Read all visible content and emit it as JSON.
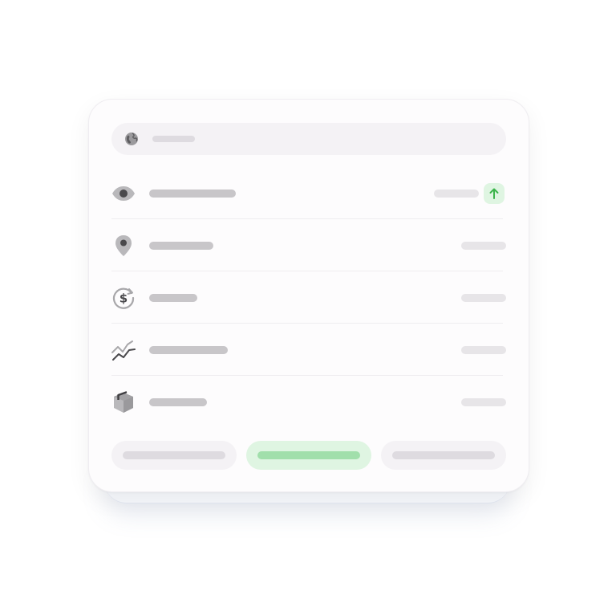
{
  "search": {
    "icon": "globe-icon",
    "placeholder_text": ""
  },
  "rows": [
    {
      "icon": "eye-icon",
      "label": "",
      "value": "",
      "trend": "up-arrow-icon"
    },
    {
      "icon": "location-pin-icon",
      "label": "",
      "value": ""
    },
    {
      "icon": "dollar-refresh-icon",
      "label": "",
      "value": ""
    },
    {
      "icon": "trend-lines-icon",
      "label": "",
      "value": ""
    },
    {
      "icon": "package-box-icon",
      "label": "",
      "value": ""
    }
  ],
  "buttons": [
    {
      "label": "",
      "style": "secondary"
    },
    {
      "label": "",
      "style": "primary"
    },
    {
      "label": "",
      "style": "secondary"
    }
  ],
  "colors": {
    "card_background": "#fdfcfd",
    "placeholder_gray": "#c8c6c9",
    "accent_green": "#3cb44b",
    "accent_green_soft": "#dff5e2"
  }
}
